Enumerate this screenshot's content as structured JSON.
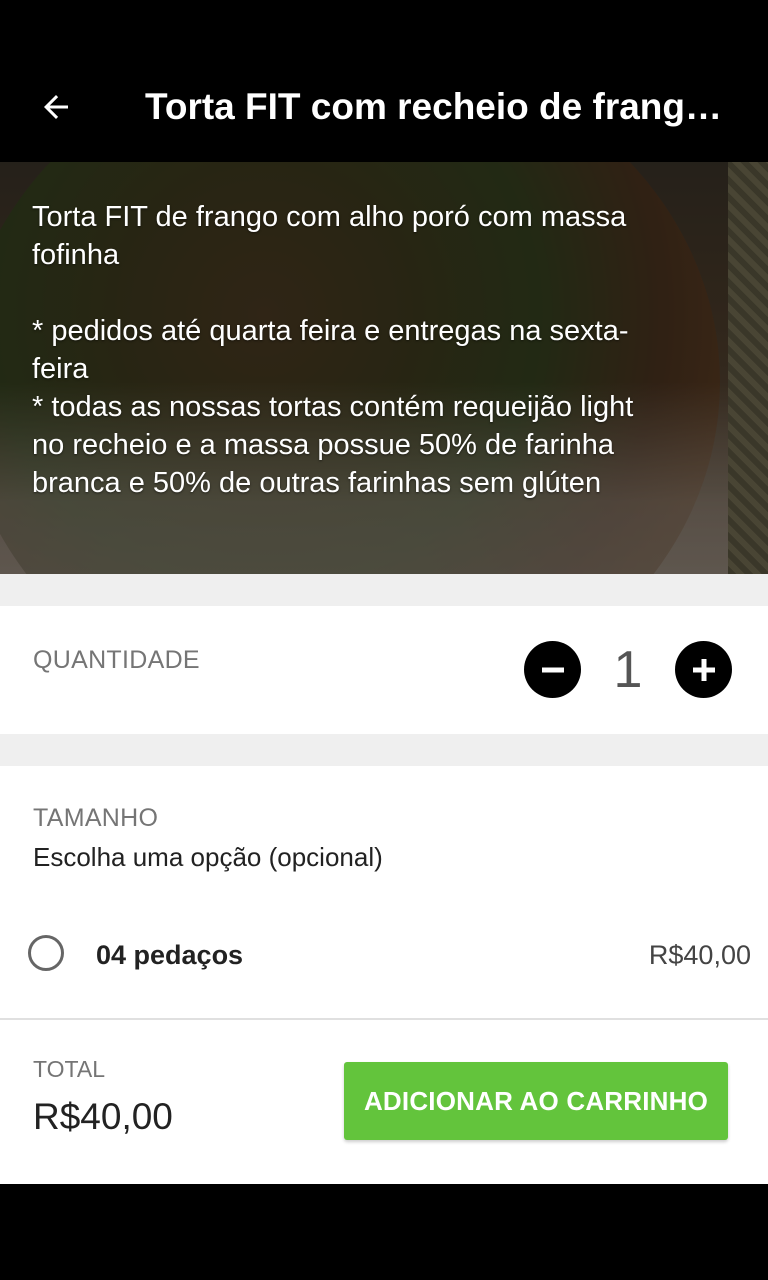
{
  "app_bar": {
    "title": "Torta FIT com recheio de frango…",
    "back_icon": "arrow-left-icon"
  },
  "hero": {
    "description": "Torta FIT de frango com alho poró com massa\nfofinha\n\n* pedidos até quarta feira e entregas na sexta-\nfeira\n* todas as nossas tortas contém requeijão light\nno recheio e a massa possue 50% de farinha\nbranca e 50% de outras farinhas sem glúten"
  },
  "quantity": {
    "label": "QUANTIDADE",
    "value": "1",
    "decrement_icon": "minus-circle-icon",
    "increment_icon": "plus-circle-icon"
  },
  "size": {
    "title": "TAMANHO",
    "subtitle": "Escolha uma opção (opcional)",
    "options": [
      {
        "label": "04 pedaços",
        "price": "R$40,00",
        "selected": false
      }
    ]
  },
  "footer": {
    "total_label": "TOTAL",
    "total_value": "R$40,00",
    "add_button": "ADICIONAR AO CARRINHO"
  },
  "colors": {
    "accent_green": "#63c43c",
    "app_bar": "#000000",
    "section_gap": "#efefef"
  }
}
